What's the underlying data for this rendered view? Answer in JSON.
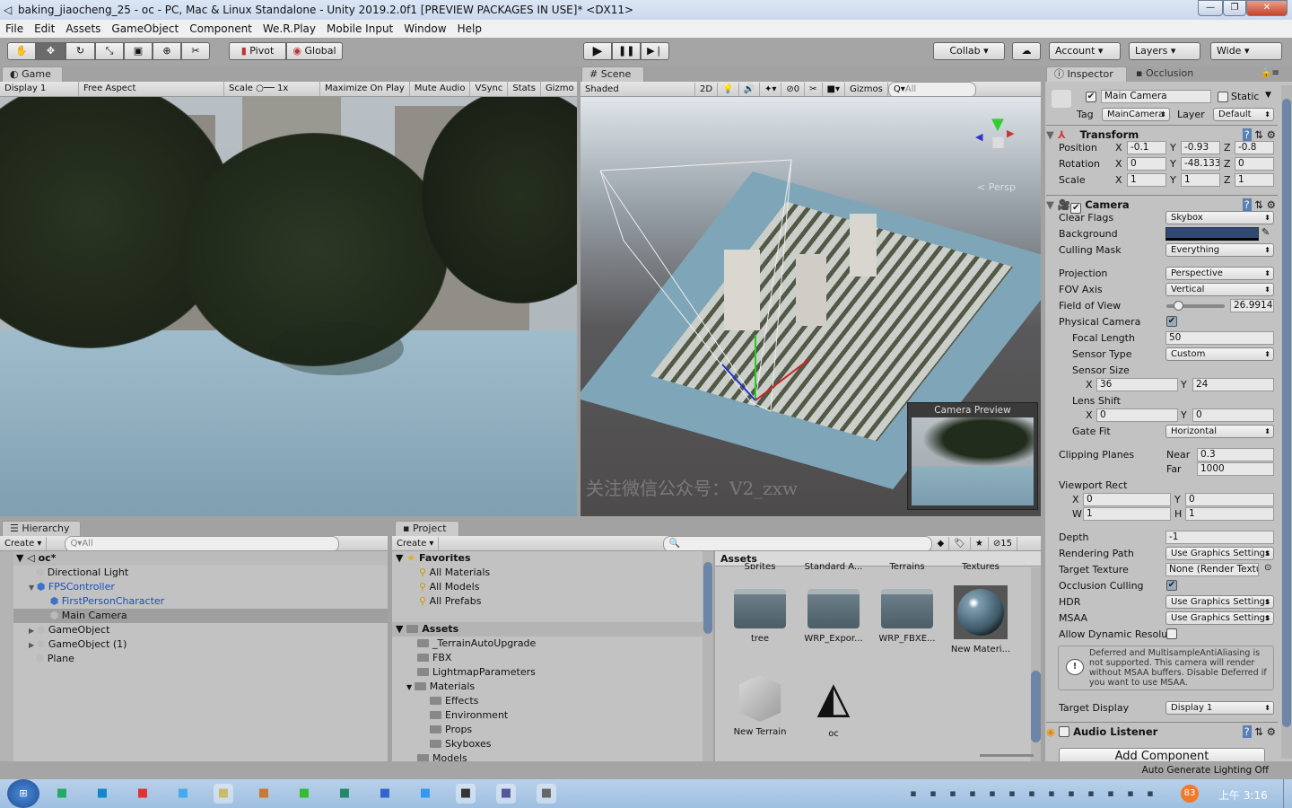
{
  "window": {
    "title": "baking_jiaocheng_25 - oc - PC, Mac & Linux Standalone - Unity 2019.2.0f1 [PREVIEW PACKAGES IN USE]* <DX11>",
    "min": "—",
    "max": "❐",
    "close": "✕"
  },
  "menu": [
    "File",
    "Edit",
    "Assets",
    "GameObject",
    "Component",
    "We.R.Play",
    "Mobile Input",
    "Window",
    "Help"
  ],
  "toolbar": {
    "tools": [
      "hand-tool",
      "move-tool",
      "rotate-tool",
      "scale-tool",
      "rect-tool",
      "transform-tool",
      "custom-tool"
    ],
    "pivot": "Pivot",
    "global": "Global",
    "collab": "Collab ▾",
    "account": "Account",
    "layers": "Layers",
    "layout": "Wide"
  },
  "game": {
    "tab": "Game",
    "display": "Display 1",
    "aspect": "Free Aspect",
    "scale_label": "Scale",
    "scale_value": "1x",
    "buttons": [
      "Maximize On Play",
      "Mute Audio",
      "VSync",
      "Stats",
      "Gizmo"
    ]
  },
  "scene": {
    "tab": "Scene",
    "shading": "Shaded",
    "mode2d": "2D",
    "hidden_count": "0",
    "gizmos": "Gizmos",
    "search": "All",
    "persp": "Persp",
    "camera_preview": "Camera Preview",
    "watermark": "关注微信公众号：V2_zxw"
  },
  "inspector": {
    "tab": "Inspector",
    "tab2": "Occlusion",
    "object_name": "Main Camera",
    "active": true,
    "static_label": "Static",
    "tag_label": "Tag",
    "tag": "MainCamera",
    "layer_label": "Layer",
    "layer": "Default",
    "transform": {
      "title": "Transform",
      "rows": [
        {
          "label": "Position",
          "x": "-0.1",
          "y": "-0.93",
          "z": "-0.8"
        },
        {
          "label": "Rotation",
          "x": "0",
          "y": "-48.133",
          "z": "0"
        },
        {
          "label": "Scale",
          "x": "1",
          "y": "1",
          "z": "1"
        }
      ]
    },
    "camera": {
      "title": "Camera",
      "clear_flags_label": "Clear Flags",
      "clear_flags": "Skybox",
      "background_label": "Background",
      "background_color": "#2f4a72",
      "culling_mask_label": "Culling Mask",
      "culling_mask": "Everything",
      "projection_label": "Projection",
      "projection": "Perspective",
      "fov_axis_label": "FOV Axis",
      "fov_axis": "Vertical",
      "fov_label": "Field of View",
      "fov": "26.9914",
      "physical_label": "Physical Camera",
      "physical": true,
      "focal_label": "Focal Length",
      "focal": "50",
      "sensor_type_label": "Sensor Type",
      "sensor_type": "Custom",
      "sensor_size_label": "Sensor Size",
      "sensor_x": "36",
      "sensor_y": "24",
      "lens_shift_label": "Lens Shift",
      "shift_x": "0",
      "shift_y": "0",
      "gate_fit_label": "Gate Fit",
      "gate_fit": "Horizontal",
      "clipping_label": "Clipping Planes",
      "near_label": "Near",
      "near": "0.3",
      "far_label": "Far",
      "far": "1000",
      "viewport_label": "Viewport Rect",
      "vx": "0",
      "vy": "0",
      "vw": "1",
      "vh": "1",
      "depth_label": "Depth",
      "depth": "-1",
      "rendering_path_label": "Rendering Path",
      "rendering_path": "Use Graphics Settings",
      "target_texture_label": "Target Texture",
      "target_texture": "None (Render Texture)",
      "occlusion_label": "Occlusion Culling",
      "occlusion": true,
      "hdr_label": "HDR",
      "hdr": "Use Graphics Settings",
      "msaa_label": "MSAA",
      "msaa": "Use Graphics Settings",
      "dynres_label": "Allow Dynamic Resolution",
      "warning": "Deferred and MultisampleAntiAliasing is not supported. This camera will render without MSAA buffers. Disable Deferred if you want to use MSAA.",
      "target_display_label": "Target Display",
      "target_display": "Display 1"
    },
    "audio_listener": "Audio Listener",
    "add_component": "Add Component"
  },
  "hierarchy": {
    "tab": "Hierarchy",
    "create": "Create ▾",
    "search": "All",
    "scene": "oc*",
    "items": [
      {
        "label": "Directional Light",
        "depth": 1,
        "blue": false
      },
      {
        "label": "FPSController",
        "depth": 1,
        "blue": true,
        "open": true
      },
      {
        "label": "FirstPersonCharacter",
        "depth": 2,
        "blue": true
      },
      {
        "label": "Main Camera",
        "depth": 2,
        "blue": false,
        "selected": true
      },
      {
        "label": "GameObject",
        "depth": 1,
        "blue": false,
        "closed": true
      },
      {
        "label": "GameObject (1)",
        "depth": 1,
        "blue": false,
        "closed": true
      },
      {
        "label": "Plane",
        "depth": 1,
        "blue": false
      }
    ]
  },
  "project": {
    "tab": "Project",
    "create": "Create ▾",
    "hidden_count": "15",
    "favorites": "Favorites",
    "fav_items": [
      "All Materials",
      "All Models",
      "All Prefabs"
    ],
    "assets": "Assets",
    "tree": [
      {
        "label": "_TerrainAutoUpgrade",
        "depth": 1
      },
      {
        "label": "FBX",
        "depth": 1
      },
      {
        "label": "LightmapParameters",
        "depth": 1
      },
      {
        "label": "Materials",
        "depth": 1
      },
      {
        "label": "Effects",
        "depth": 2
      },
      {
        "label": "Environment",
        "depth": 2
      },
      {
        "label": "Props",
        "depth": 2
      },
      {
        "label": "Skyboxes",
        "depth": 2
      },
      {
        "label": "Models",
        "depth": 1
      }
    ],
    "grid_title": "Assets",
    "cut_row": [
      "Sprites",
      "Standard A...",
      "Terrains",
      "Textures"
    ],
    "grid": [
      {
        "label": "tree",
        "kind": "folder"
      },
      {
        "label": "WRP_Expor...",
        "kind": "folder"
      },
      {
        "label": "WRP_FBXE...",
        "kind": "folder"
      },
      {
        "label": "New Materi...",
        "kind": "material"
      },
      {
        "label": "New Terrain",
        "kind": "terrain"
      },
      {
        "label": "oc",
        "kind": "unity"
      }
    ]
  },
  "status": "Auto Generate Lighting Off",
  "taskbar": {
    "icons": [
      "windows-start",
      "cmd",
      "ie",
      "chrome",
      "app",
      "explorer",
      "winrar",
      "dvd",
      "app2",
      "app3",
      "app4",
      "unity",
      "vm",
      "display"
    ],
    "battery": "83",
    "clock": "上午 3:16"
  }
}
